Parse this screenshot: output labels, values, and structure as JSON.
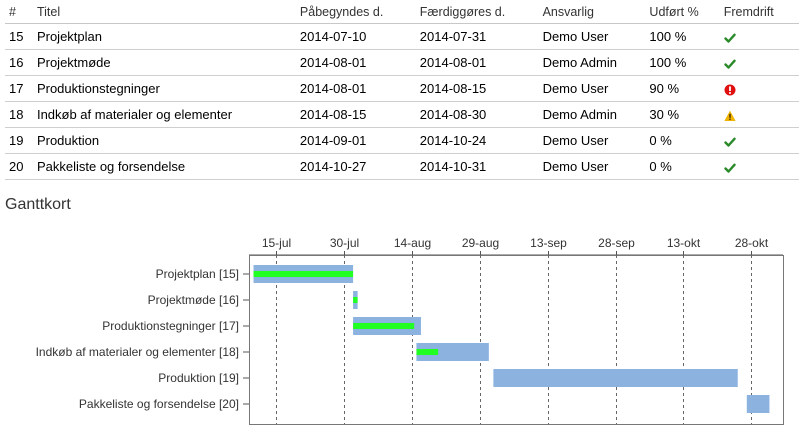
{
  "table": {
    "headers": [
      "#",
      "Titel",
      "Påbegyndes d.",
      "Færdiggøres d.",
      "Ansvarlig",
      "Udført %",
      "Fremdrift"
    ],
    "rows": [
      {
        "id": "15",
        "title": "Projektplan",
        "start": "2014-07-10",
        "end": "2014-07-31",
        "owner": "Demo User",
        "done": "100 %",
        "status": "check-icon"
      },
      {
        "id": "16",
        "title": "Projektmøde",
        "start": "2014-08-01",
        "end": "2014-08-01",
        "owner": "Demo Admin",
        "done": "100 %",
        "status": "check-icon"
      },
      {
        "id": "17",
        "title": "Produktionstegninger",
        "start": "2014-08-01",
        "end": "2014-08-15",
        "owner": "Demo User",
        "done": "90 %",
        "status": "error-icon"
      },
      {
        "id": "18",
        "title": "Indkøb af materialer og elementer",
        "start": "2014-08-15",
        "end": "2014-08-30",
        "owner": "Demo Admin",
        "done": "30 %",
        "status": "warning-icon"
      },
      {
        "id": "19",
        "title": "Produktion",
        "start": "2014-09-01",
        "end": "2014-10-24",
        "owner": "Demo User",
        "done": "0 %",
        "status": "check-icon"
      },
      {
        "id": "20",
        "title": "Pakkeliste og forsendelse",
        "start": "2014-10-27",
        "end": "2014-10-31",
        "owner": "Demo User",
        "done": "0 %",
        "status": "check-icon"
      }
    ]
  },
  "gantt": {
    "title": "Ganttkort",
    "tick_labels": [
      "15-jul",
      "30-jul",
      "14-aug",
      "29-aug",
      "13-sep",
      "28-sep",
      "13-okt",
      "28-okt"
    ],
    "tick_dates": [
      "2014-07-15",
      "2014-07-30",
      "2014-08-14",
      "2014-08-29",
      "2014-09-13",
      "2014-09-28",
      "2014-10-13",
      "2014-10-28"
    ],
    "axis_range": [
      "2014-07-09",
      "2014-11-04"
    ],
    "tasks": [
      {
        "label": "Projektplan [15]",
        "start": "2014-07-10",
        "end": "2014-07-31",
        "progress": 1.0
      },
      {
        "label": "Projektmøde [16]",
        "start": "2014-08-01",
        "end": "2014-08-01",
        "progress": 1.0
      },
      {
        "label": "Produktionstegninger [17]",
        "start": "2014-08-01",
        "end": "2014-08-15",
        "progress": 0.9
      },
      {
        "label": "Indkøb af materialer og elementer [18]",
        "start": "2014-08-15",
        "end": "2014-08-30",
        "progress": 0.3
      },
      {
        "label": "Produktion [19]",
        "start": "2014-09-01",
        "end": "2014-10-24",
        "progress": 0.0
      },
      {
        "label": "Pakkeliste og forsendelse [20]",
        "start": "2014-10-27",
        "end": "2014-10-31",
        "progress": 0.0
      }
    ],
    "colors": {
      "bar": "#8cb2e0",
      "progress": "#22ff22",
      "grid": "#666666",
      "check": "#2a8a2a",
      "error": "#e01010",
      "warning": "#f0b400"
    }
  }
}
